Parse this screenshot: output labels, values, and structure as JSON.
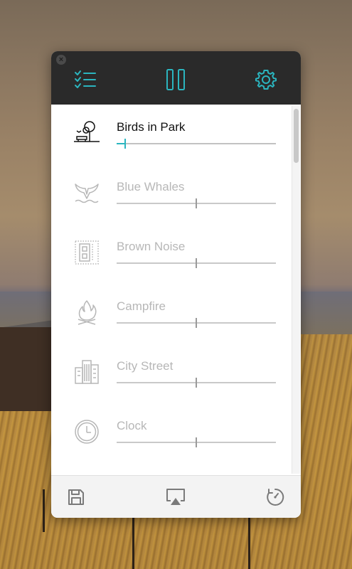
{
  "colors": {
    "accent": "#2bb5bf",
    "topbar": "#2a2a2a",
    "inactive_text": "#b7b7b7",
    "active_text": "#111111"
  },
  "toolbar": {
    "close_glyph": "×",
    "left_icon": "checklist-icon",
    "center_icon": "pause-icon",
    "right_icon": "gear-icon"
  },
  "sounds": [
    {
      "label": "Birds in Park",
      "icon": "park-tree-bench-icon",
      "active": true,
      "level": 0.05
    },
    {
      "label": "Blue Whales",
      "icon": "whale-tail-icon",
      "active": false,
      "level": 0.5
    },
    {
      "label": "Brown Noise",
      "icon": "brown-noise-icon",
      "active": false,
      "level": 0.5
    },
    {
      "label": "Campfire",
      "icon": "campfire-icon",
      "active": false,
      "level": 0.5
    },
    {
      "label": "City Street",
      "icon": "city-buildings-icon",
      "active": false,
      "level": 0.5
    },
    {
      "label": "Clock",
      "icon": "clock-icon",
      "active": false,
      "level": 0.5
    }
  ],
  "bottom_bar": {
    "left_icon": "save-icon",
    "center_icon": "airplay-icon",
    "right_icon": "timer-icon"
  }
}
